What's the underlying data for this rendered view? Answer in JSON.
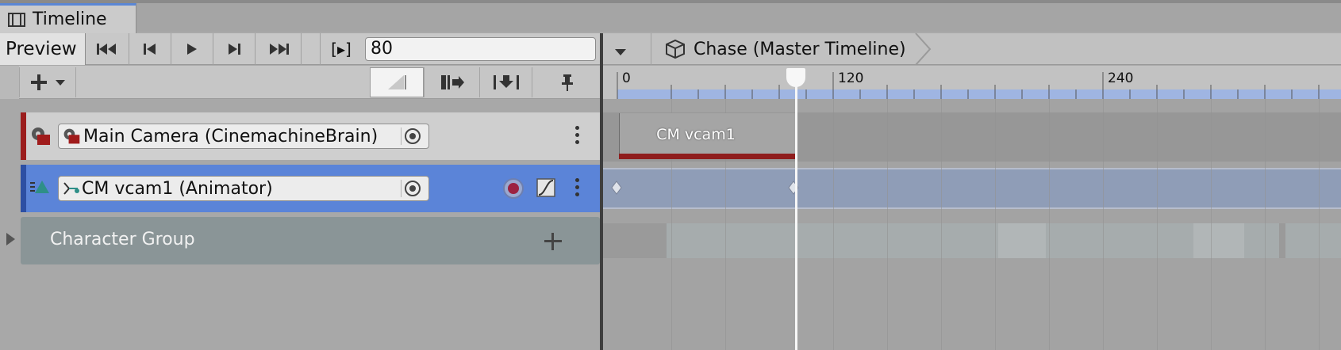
{
  "window": {
    "tab_label": "Timeline",
    "tab_icon": "film-icon",
    "accent_color": "#5b87d5"
  },
  "toolbar": {
    "preview_label": "Preview",
    "current_frame": "80",
    "frame_mode_label": "[▸]"
  },
  "breadcrumb": {
    "label": "Chase (Master Timeline)"
  },
  "ruler": {
    "ticks": [
      "0",
      "120",
      "240"
    ]
  },
  "tracks": [
    {
      "label": "Main Camera (CinemachineBrain)",
      "color": "#9b1d1d"
    },
    {
      "label": "CM vcam1 (Animator)",
      "color": "#2d4fa3"
    },
    {
      "label": "Character Group"
    }
  ],
  "clips": {
    "camera_clip_label": "CM vcam1"
  }
}
